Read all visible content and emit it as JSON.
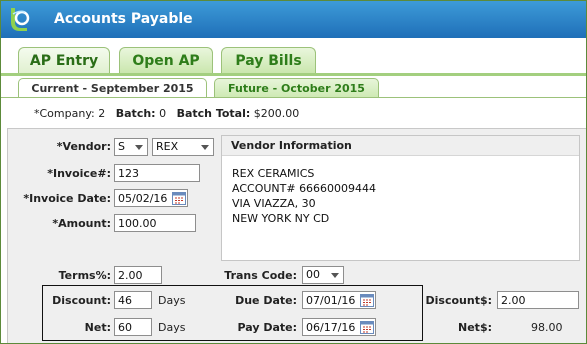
{
  "app": {
    "title": "Accounts Payable"
  },
  "tabs": [
    {
      "label": "AP Entry"
    },
    {
      "label": "Open AP"
    },
    {
      "label": "Pay Bills"
    }
  ],
  "subtabs": [
    {
      "label": "Current - September 2015"
    },
    {
      "label": "Future - October 2015"
    }
  ],
  "summary": {
    "company_label": "*Company:",
    "company_value": "2",
    "batch_label": "Batch:",
    "batch_value": "0",
    "batch_total_label": "Batch Total:",
    "batch_total_value": "$200.00"
  },
  "form": {
    "vendor_label": "*Vendor:",
    "vendor_type": "S",
    "vendor_code": "REX",
    "invoice_label": "*Invoice#:",
    "invoice_value": "123",
    "invoice_date_label": "*Invoice Date:",
    "invoice_date_value": "05/02/16",
    "amount_label": "*Amount:",
    "amount_value": "100.00",
    "terms_label": "Terms%:",
    "terms_value": "2.00",
    "trans_code_label": "Trans Code:",
    "trans_code_value": "00",
    "discount_label": "Discount:",
    "discount_days": "46",
    "net_label": "Net:",
    "net_days": "60",
    "days_text": "Days",
    "due_date_label": "Due Date:",
    "due_date_value": "07/01/16",
    "pay_date_label": "Pay Date:",
    "pay_date_value": "06/17/16",
    "discount_amt_label": "Discount$:",
    "discount_amt_value": "2.00",
    "net_amt_label": "Net$:",
    "net_amt_value": "98.00"
  },
  "vendor_info": {
    "header": "Vendor Information",
    "lines": [
      "REX CERAMICS",
      "ACCOUNT# 66660009444",
      "VIA VIAZZA, 30",
      "NEW YORK NY CD"
    ]
  },
  "icons": {
    "logo": "app-logo-icon",
    "calendar": "calendar-icon",
    "dropdown": "chevron-down-icon"
  },
  "colors": {
    "title_bar": "#1f6fb8",
    "tab_green": "#2e7d1a",
    "tab_bg": "#c9e6ac",
    "form_bg": "#efefef"
  }
}
